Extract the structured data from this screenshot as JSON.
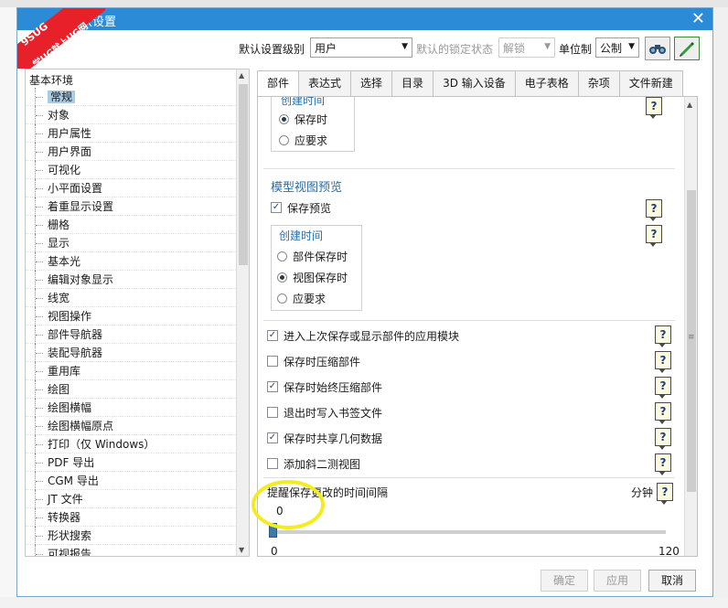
{
  "window": {
    "title": "默认设置",
    "watermark_line1": "9SUG",
    "watermark_line2": "学UG就上UG网"
  },
  "toolbar": {
    "level_label": "默认设置级别",
    "level_value": "用户",
    "lock_label": "默认的锁定状态",
    "lock_value": "解锁",
    "unit_label": "单位制",
    "unit_value": "公制"
  },
  "tree": {
    "root": "基本环境",
    "items": [
      "常规",
      "对象",
      "用户属性",
      "用户界面",
      "可视化",
      "小平面设置",
      "着重显示设置",
      "栅格",
      "显示",
      "基本光",
      "编辑对象显示",
      "线宽",
      "视图操作",
      "部件导航器",
      "装配导航器",
      "重用库",
      "绘图",
      "绘图横幅",
      "绘图横幅原点",
      "打印（仅 Windows）",
      "PDF 导出",
      "CGM 导出",
      "JT 文件",
      "转换器",
      "形状搜索",
      "可视报告"
    ],
    "selected_index": 0
  },
  "tabs": [
    "部件",
    "表达式",
    "选择",
    "目录",
    "3D 输入设备",
    "电子表格",
    "杂项",
    "文件新建"
  ],
  "panel": {
    "group1": {
      "title": "创建时间",
      "options": [
        "保存时",
        "应要求"
      ],
      "selected": 0
    },
    "preview": {
      "title": "模型视图预览",
      "save_preview": "保存预览",
      "sub_title": "创建时间",
      "options": [
        "部件保存时",
        "视图保存时",
        "应要求"
      ],
      "selected": 1
    },
    "checks": [
      {
        "label": "进入上次保存或显示部件的应用模块",
        "checked": true
      },
      {
        "label": "保存时压缩部件",
        "checked": false
      },
      {
        "label": "保存时始终压缩部件",
        "checked": true
      },
      {
        "label": "退出时写入书签文件",
        "checked": false
      },
      {
        "label": "保存时共享几何数据",
        "checked": true
      },
      {
        "label": "添加斜二测视图",
        "checked": false
      }
    ],
    "interval": {
      "label": "提醒保存更改的时间间隔",
      "unit": "分钟",
      "value": "0",
      "min": "0",
      "max": "120",
      "fraction": 0
    },
    "help_glyph": "?"
  },
  "buttons": {
    "ok": "确定",
    "apply": "应用",
    "cancel": "取消"
  },
  "colors": {
    "titlebar": "#2c8bd6",
    "selection": "#a9cbe3",
    "highlight_circle": "#f4ec1f",
    "watermark": "#e8202a"
  }
}
